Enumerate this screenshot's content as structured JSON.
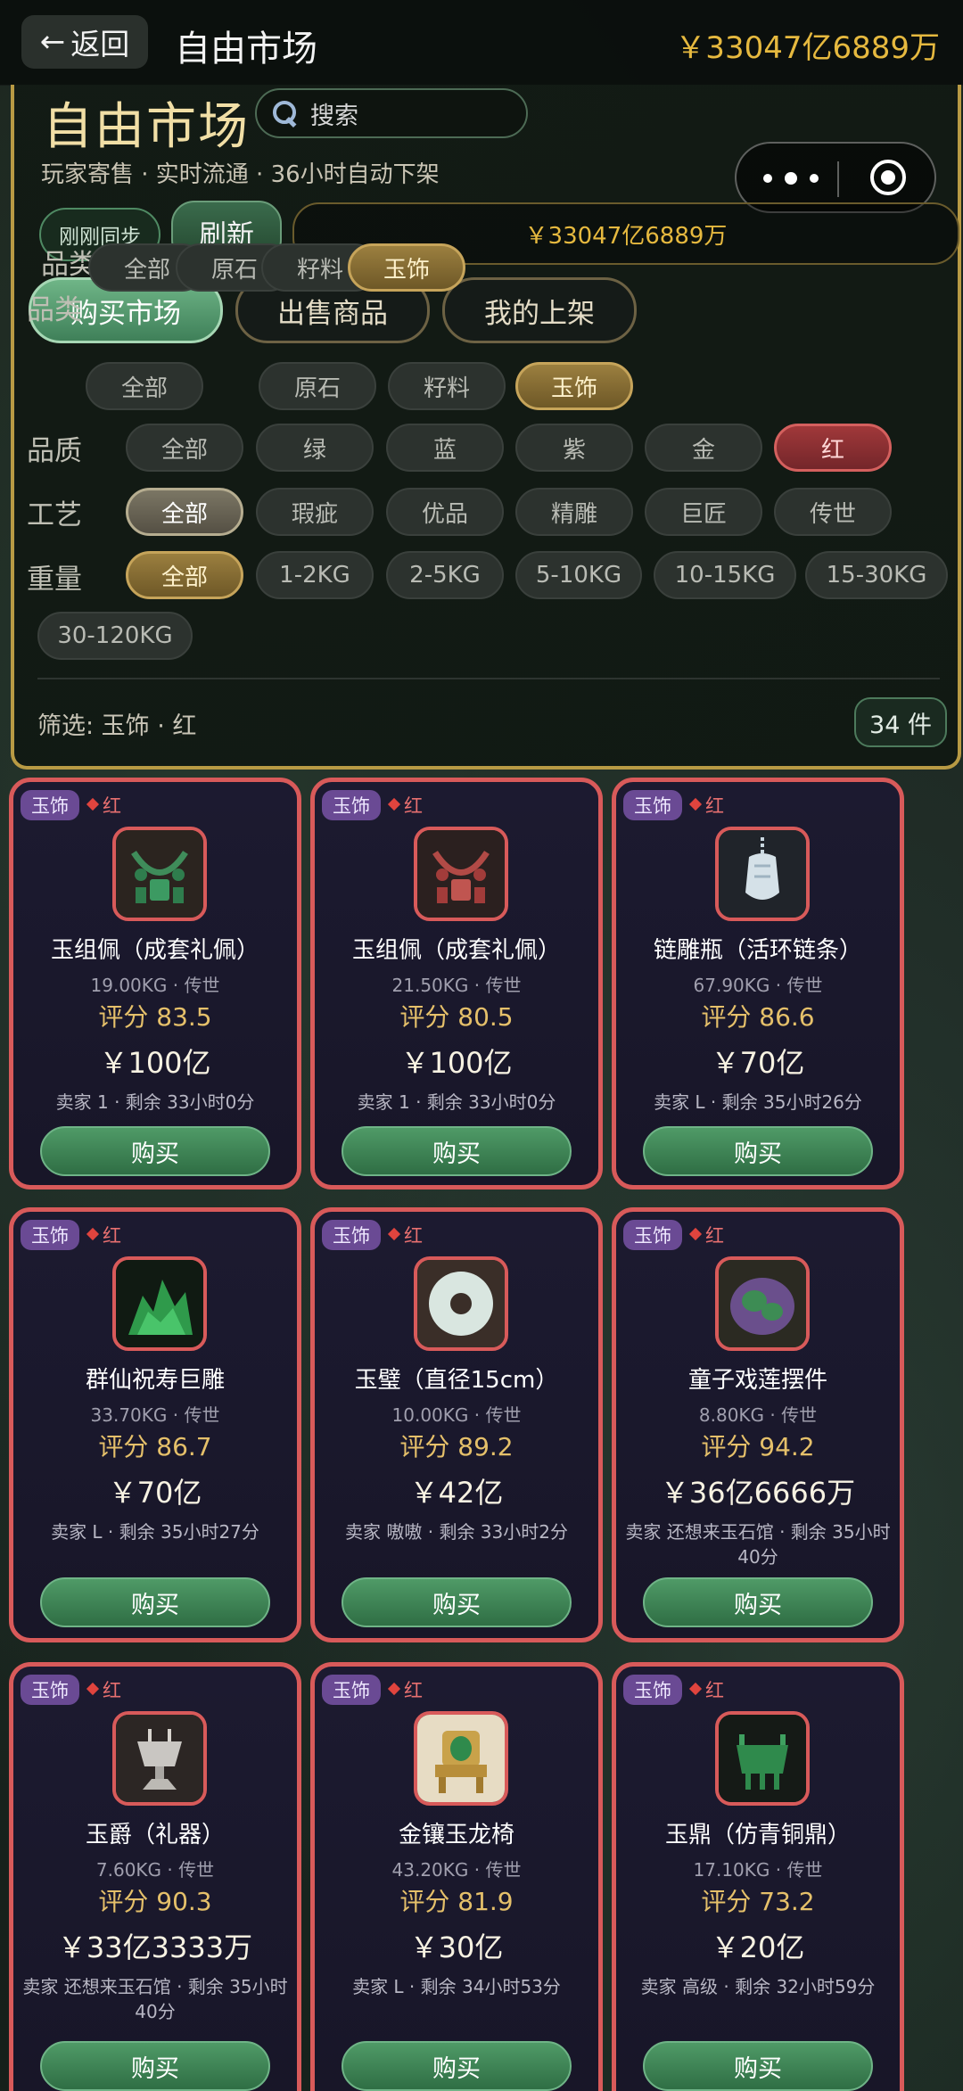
{
  "nav": {
    "back_label": "返回",
    "back_arrow": "←",
    "title": "自由市场",
    "balance": "￥33047亿6889万"
  },
  "header": {
    "title": "自由市场",
    "search_placeholder": "搜索",
    "subtitle": "玩家寄售 · 实时流通 · 36小时自动下架",
    "sync_status": "刚刚同步",
    "refresh_label": "刷新",
    "balance": "￥33047亿6889万"
  },
  "tabs": [
    {
      "label": "购买市场",
      "active": true
    },
    {
      "label": "出售商品",
      "active": false
    },
    {
      "label": "我的上架",
      "active": false
    }
  ],
  "filters": {
    "category": {
      "label": "品类",
      "options": [
        "全部",
        "原石",
        "籽料",
        "玉饰"
      ],
      "selected": "玉饰"
    },
    "quality": {
      "label": "品质",
      "options": [
        "全部",
        "绿",
        "蓝",
        "紫",
        "金",
        "红"
      ],
      "selected": "红"
    },
    "craft": {
      "label": "工艺",
      "options": [
        "全部",
        "瑕疵",
        "优品",
        "精雕",
        "巨匠",
        "传世"
      ],
      "selected": "全部"
    },
    "weight": {
      "label": "重量",
      "options": [
        "全部",
        "1-2KG",
        "2-5KG",
        "5-10KG",
        "10-15KG",
        "15-30KG",
        "30-120KG"
      ],
      "selected": "全部"
    }
  },
  "summary": {
    "text": "筛选: 玉饰 · 红",
    "count": "34 件"
  },
  "colors": {
    "accent_gold": "#e6b93f",
    "card_border_red": "#d85a5a",
    "buy_green": "#3f8a57",
    "tag_purple": "#6a4a94"
  },
  "items": [
    {
      "category": "玉饰",
      "quality": "红",
      "name": "玉组佩（成套礼佩）",
      "meta": "19.00KG · 传世",
      "score": "评分 83.5",
      "price": "￥100亿",
      "seller": "卖家 1 · 剩余 33小时0分",
      "buy_label": "购买",
      "icon": "jade-necklace-green"
    },
    {
      "category": "玉饰",
      "quality": "红",
      "name": "玉组佩（成套礼佩）",
      "meta": "21.50KG · 传世",
      "score": "评分 80.5",
      "price": "￥100亿",
      "seller": "卖家 1 · 剩余 33小时0分",
      "buy_label": "购买",
      "icon": "jade-necklace-red"
    },
    {
      "category": "玉饰",
      "quality": "红",
      "name": "链雕瓶（活环链条）",
      "meta": "67.90KG · 传世",
      "score": "评分 86.6",
      "price": "￥70亿",
      "seller": "卖家 L · 剩余 35小时26分",
      "buy_label": "购买",
      "icon": "chain-vase"
    },
    {
      "category": "玉饰",
      "quality": "红",
      "name": "群仙祝寿巨雕",
      "meta": "33.70KG · 传世",
      "score": "评分 86.7",
      "price": "￥70亿",
      "seller": "卖家 L · 剩余 35小时27分",
      "buy_label": "购买",
      "icon": "mountain-carving"
    },
    {
      "category": "玉饰",
      "quality": "红",
      "name": "玉璧（直径15cm）",
      "meta": "10.00KG · 传世",
      "score": "评分 89.2",
      "price": "￥42亿",
      "seller": "卖家 嗷嗷 · 剩余 33小时2分",
      "buy_label": "购买",
      "icon": "jade-disc"
    },
    {
      "category": "玉饰",
      "quality": "红",
      "name": "童子戏莲摆件",
      "meta": "8.80KG · 传世",
      "score": "评分 94.2",
      "price": "￥36亿6666万",
      "seller": "卖家 还想来玉石馆 · 剩余 35小时40分",
      "buy_label": "购买",
      "icon": "lotus-ornament"
    },
    {
      "category": "玉饰",
      "quality": "红",
      "name": "玉爵（礼器）",
      "meta": "7.60KG · 传世",
      "score": "评分 90.3",
      "price": "￥33亿3333万",
      "seller": "卖家 还想来玉石馆 · 剩余 35小时40分",
      "buy_label": "购买",
      "icon": "jade-goblet"
    },
    {
      "category": "玉饰",
      "quality": "红",
      "name": "金镶玉龙椅",
      "meta": "43.20KG · 传世",
      "score": "评分 81.9",
      "price": "￥30亿",
      "seller": "卖家 L · 剩余 34小时53分",
      "buy_label": "购买",
      "icon": "dragon-throne"
    },
    {
      "category": "玉饰",
      "quality": "红",
      "name": "玉鼎（仿青铜鼎）",
      "meta": "17.10KG · 传世",
      "score": "评分 73.2",
      "price": "￥20亿",
      "seller": "卖家 高级 · 剩余 32小时59分",
      "buy_label": "购买",
      "icon": "jade-cauldron"
    }
  ]
}
